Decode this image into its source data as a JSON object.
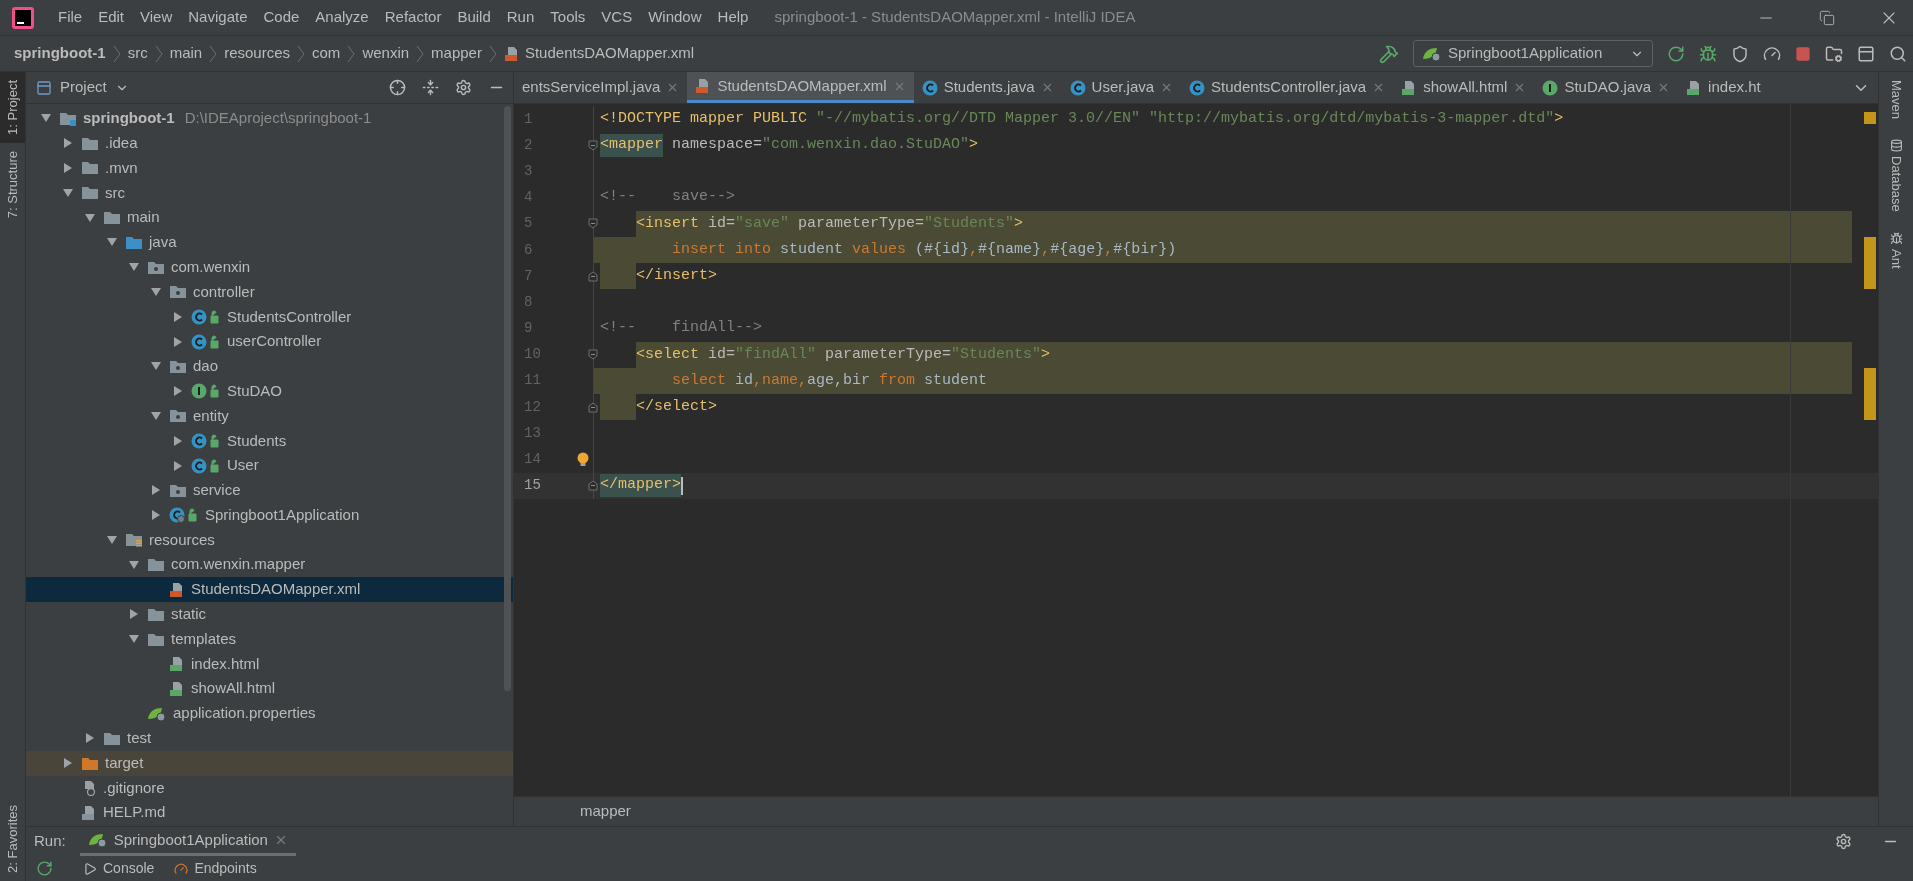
{
  "window": {
    "title": "springboot-1 - StudentsDAOMapper.xml - IntelliJ IDEA"
  },
  "menu": [
    "File",
    "Edit",
    "View",
    "Navigate",
    "Code",
    "Analyze",
    "Refactor",
    "Build",
    "Run",
    "Tools",
    "VCS",
    "Window",
    "Help"
  ],
  "breadcrumb": [
    {
      "text": "springboot-1",
      "kind": "project"
    },
    {
      "text": "src",
      "kind": "folder"
    },
    {
      "text": "main",
      "kind": "folder"
    },
    {
      "text": "resources",
      "kind": "folder"
    },
    {
      "text": "com",
      "kind": "folder"
    },
    {
      "text": "wenxin",
      "kind": "folder"
    },
    {
      "text": "mapper",
      "kind": "folder"
    },
    {
      "text": "StudentsDAOMapper.xml",
      "kind": "xml"
    }
  ],
  "run_config": "Springboot1Application",
  "left_strip": {
    "top": [
      {
        "label": "1: Project",
        "selected": true
      },
      {
        "label": "7: Structure",
        "selected": false
      }
    ],
    "bottom": [
      {
        "label": "2: Favorites",
        "selected": false
      }
    ]
  },
  "right_strip": [
    "Maven",
    "Database",
    "Ant"
  ],
  "project_panel": {
    "title": "Project",
    "tree": [
      {
        "name": "springboot-1",
        "path": "D:\\IDEAproject\\springboot-1",
        "kind": "module",
        "expanded": true,
        "selected": false,
        "children": [
          {
            "name": ".idea",
            "kind": "folder",
            "expanded": false,
            "selected": false
          },
          {
            "name": ".mvn",
            "kind": "folder",
            "expanded": false,
            "selected": false
          },
          {
            "name": "src",
            "kind": "folder",
            "expanded": true,
            "selected": false,
            "children": [
              {
                "name": "main",
                "kind": "folder",
                "expanded": true,
                "selected": false,
                "children": [
                  {
                    "name": "java",
                    "kind": "source",
                    "expanded": true,
                    "selected": false,
                    "children": [
                      {
                        "name": "com.wenxin",
                        "kind": "package",
                        "expanded": true,
                        "selected": false,
                        "children": [
                          {
                            "name": "controller",
                            "kind": "package",
                            "expanded": true,
                            "selected": false,
                            "children": [
                              {
                                "name": "StudentsController",
                                "kind": "class",
                                "expanded": false,
                                "selected": false
                              },
                              {
                                "name": "userController",
                                "kind": "class",
                                "expanded": false,
                                "selected": false
                              }
                            ]
                          },
                          {
                            "name": "dao",
                            "kind": "package",
                            "expanded": true,
                            "selected": false,
                            "children": [
                              {
                                "name": "StuDAO",
                                "kind": "interface",
                                "expanded": false,
                                "selected": false
                              }
                            ]
                          },
                          {
                            "name": "entity",
                            "kind": "package",
                            "expanded": true,
                            "selected": false,
                            "children": [
                              {
                                "name": "Students",
                                "kind": "class",
                                "expanded": false,
                                "selected": false
                              },
                              {
                                "name": "User",
                                "kind": "class",
                                "expanded": false,
                                "selected": false
                              }
                            ]
                          },
                          {
                            "name": "service",
                            "kind": "package",
                            "expanded": false,
                            "selected": false
                          },
                          {
                            "name": "Springboot1Application",
                            "kind": "app",
                            "expanded": false,
                            "selected": false
                          }
                        ]
                      }
                    ]
                  },
                  {
                    "name": "resources",
                    "kind": "resources",
                    "expanded": true,
                    "selected": false,
                    "children": [
                      {
                        "name": "com.wenxin.mapper",
                        "kind": "folder",
                        "expanded": true,
                        "selected": false,
                        "children": [
                          {
                            "name": "StudentsDAOMapper.xml",
                            "kind": "xml",
                            "selected": true
                          }
                        ]
                      },
                      {
                        "name": "static",
                        "kind": "folder",
                        "expanded": false,
                        "selected": false
                      },
                      {
                        "name": "templates",
                        "kind": "folder",
                        "expanded": true,
                        "selected": false,
                        "children": [
                          {
                            "name": "index.html",
                            "kind": "html",
                            "selected": false
                          },
                          {
                            "name": "showAll.html",
                            "kind": "html",
                            "selected": false
                          }
                        ]
                      },
                      {
                        "name": "application.properties",
                        "kind": "spring",
                        "selected": false
                      }
                    ]
                  }
                ]
              },
              {
                "name": "test",
                "kind": "folder",
                "expanded": false,
                "selected": false
              }
            ]
          },
          {
            "name": "target",
            "kind": "excluded",
            "expanded": false,
            "selected": false
          },
          {
            "name": ".gitignore",
            "kind": "ignore",
            "selected": false
          },
          {
            "name": "HELP.md",
            "kind": "markdown",
            "selected": false
          }
        ]
      }
    ]
  },
  "tabs": [
    {
      "label": "entsServiceImpl.java",
      "kind": "plain",
      "selected": false
    },
    {
      "label": "StudentsDAOMapper.xml",
      "kind": "xml",
      "selected": true
    },
    {
      "label": "Students.java",
      "kind": "class",
      "selected": false
    },
    {
      "label": "User.java",
      "kind": "class",
      "selected": false
    },
    {
      "label": "StudentsController.java",
      "kind": "class",
      "selected": false
    },
    {
      "label": "showAll.html",
      "kind": "html",
      "selected": false
    },
    {
      "label": "StuDAO.java",
      "kind": "interface",
      "selected": false
    },
    {
      "label": "index.ht",
      "kind": "html",
      "selected": false
    }
  ],
  "editor": {
    "lines": [
      {
        "number": "1",
        "current": false,
        "tokens": [
          {
            "text": "<!DOCTYPE mapper PUBLIC ",
            "kind": "tag"
          },
          {
            "text": "\"-//mybatis.org//DTD Mapper 3.0//EN\" \"http://mybatis.org/dtd/mybatis-3-mapper.dtd\"",
            "kind": "str"
          },
          {
            "text": ">",
            "kind": "tag"
          }
        ]
      },
      {
        "number": "2",
        "current": false,
        "fold_start": true,
        "tokens": [
          {
            "text": "<mapper",
            "kind": "tag_match"
          },
          {
            "text": " namespace=",
            "kind": "attr"
          },
          {
            "text": "\"com.wenxin.dao.StuDAO\"",
            "kind": "str"
          },
          {
            "text": ">",
            "kind": "tag"
          }
        ]
      },
      {
        "number": "3",
        "current": false
      },
      {
        "number": "4",
        "current": false,
        "tokens": [
          {
            "text": "<!--    save-->",
            "kind": "comment"
          }
        ]
      },
      {
        "number": "5",
        "current": false,
        "fold_start": true,
        "match_start": true,
        "indented": true,
        "tokens": [
          {
            "text": "<insert",
            "kind": "tag"
          },
          {
            "text": " id=",
            "kind": "attr"
          },
          {
            "text": "\"save\"",
            "kind": "str"
          },
          {
            "text": " parameterType=",
            "kind": "attr"
          },
          {
            "text": "\"Students\"",
            "kind": "str"
          },
          {
            "text": ">",
            "kind": "tag"
          }
        ]
      },
      {
        "number": "6",
        "current": false,
        "match_body": true,
        "indented_twice": true,
        "tokens": [
          {
            "text": "insert into",
            "kind": "kw"
          },
          {
            "text": " student ",
            "kind": "text"
          },
          {
            "text": "values",
            "kind": "kw"
          },
          {
            "text": " (#{id}",
            "kind": "text"
          },
          {
            "text": ",",
            "kind": "kw"
          },
          {
            "text": "#{name}",
            "kind": "text"
          },
          {
            "text": ",",
            "kind": "kw"
          },
          {
            "text": "#{age}",
            "kind": "text"
          },
          {
            "text": ",",
            "kind": "kw"
          },
          {
            "text": "#{bir})",
            "kind": "text"
          }
        ]
      },
      {
        "number": "7",
        "current": false,
        "fold_end": true,
        "match_end": true,
        "indented": true,
        "tokens": [
          {
            "text": "</insert>",
            "kind": "tag"
          }
        ]
      },
      {
        "number": "8",
        "current": false
      },
      {
        "number": "9",
        "current": false,
        "tokens": [
          {
            "text": "<!--    findAll-->",
            "kind": "comment"
          }
        ]
      },
      {
        "number": "10",
        "current": false,
        "fold_start": true,
        "match_start": true,
        "indented": true,
        "tokens": [
          {
            "text": "<select",
            "kind": "tag"
          },
          {
            "text": " id=",
            "kind": "attr"
          },
          {
            "text": "\"findAll\"",
            "kind": "str"
          },
          {
            "text": " parameterType=",
            "kind": "attr"
          },
          {
            "text": "\"Students\"",
            "kind": "str"
          },
          {
            "text": ">",
            "kind": "tag"
          }
        ]
      },
      {
        "number": "11",
        "current": false,
        "match_body": true,
        "indented_twice": true,
        "tokens": [
          {
            "text": "select",
            "kind": "kw"
          },
          {
            "text": " id",
            "kind": "text"
          },
          {
            "text": ",name,",
            "kind": "kw"
          },
          {
            "text": "age,bir ",
            "kind": "text"
          },
          {
            "text": "from",
            "kind": "kw"
          },
          {
            "text": " student",
            "kind": "text"
          }
        ]
      },
      {
        "number": "12",
        "current": false,
        "fold_end": true,
        "match_end": true,
        "indented": true,
        "tokens": [
          {
            "text": "</select>",
            "kind": "tag"
          }
        ]
      },
      {
        "number": "13",
        "current": false
      },
      {
        "number": "14",
        "current": false,
        "intention_bulb": true
      },
      {
        "number": "15",
        "current": true,
        "fold_end": true,
        "tokens": [
          {
            "text": "</mapper>",
            "kind": "tag_match"
          }
        ]
      }
    ],
    "breadcrumb": "mapper"
  },
  "run_panel": {
    "label": "Run:",
    "tab": "Springboot1Application",
    "tools": [
      {
        "label": "Console",
        "kind": "console"
      },
      {
        "label": "Endpoints",
        "kind": "endpoints"
      }
    ]
  }
}
